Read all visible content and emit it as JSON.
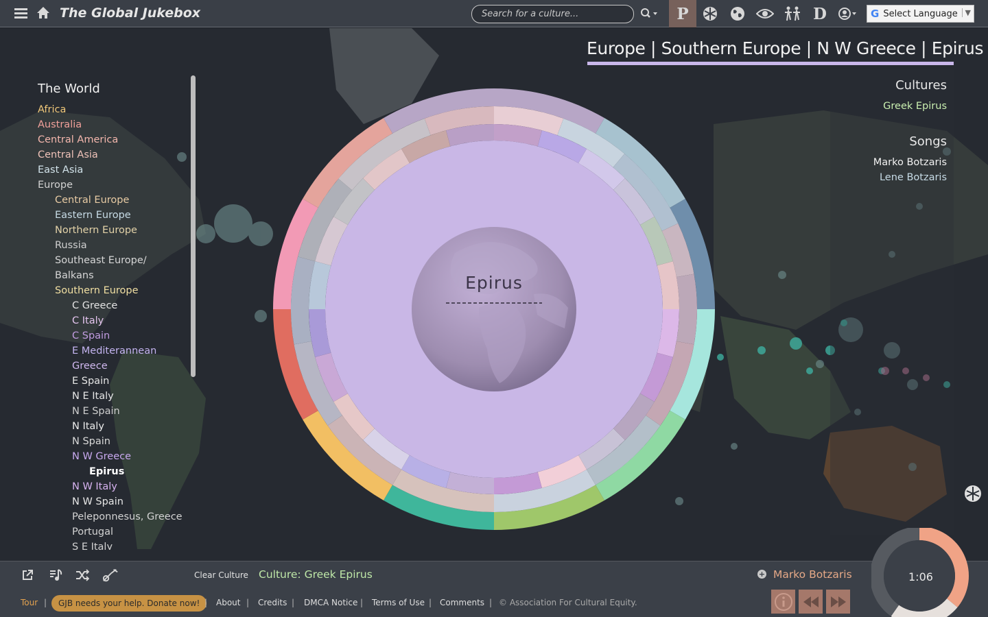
{
  "app": {
    "title": "The Global Jukebox"
  },
  "search": {
    "placeholder": "Search for a culture..."
  },
  "nav_icons": [
    {
      "name": "p-icon",
      "glyph": "P",
      "active": true
    },
    {
      "name": "dancer-wheel-icon",
      "glyph": "",
      "active": false
    },
    {
      "name": "globe-icon",
      "glyph": "",
      "active": false
    },
    {
      "name": "eye-icon",
      "glyph": "",
      "active": false
    },
    {
      "name": "dancers-icon",
      "glyph": "",
      "active": false
    },
    {
      "name": "d-icon",
      "glyph": "D",
      "active": false
    },
    {
      "name": "user-icon",
      "glyph": "",
      "active": false
    }
  ],
  "language": {
    "label": "Select Language"
  },
  "breadcrumb": {
    "text": "Europe | Southern Europe | N W Greece | Epirus"
  },
  "tree": {
    "heading": "The World",
    "items": [
      {
        "label": "Africa",
        "color": "#f2c97a"
      },
      {
        "label": "Australia",
        "color": "#f0a09a"
      },
      {
        "label": "Central America",
        "color": "#f4b7ad"
      },
      {
        "label": "Central Asia",
        "color": "#f0c3b9"
      },
      {
        "label": "East Asia",
        "color": "#d2e3ea"
      },
      {
        "label": "Europe",
        "color": "#d3d3d3"
      },
      {
        "label": "Central Europe",
        "color": "#e8cba4"
      },
      {
        "label": "Eastern Europe",
        "color": "#c7dbe6"
      },
      {
        "label": "Northern Europe",
        "color": "#e3d2a8"
      },
      {
        "label": "Russia",
        "color": "#d0d0d0"
      },
      {
        "label": "Southeast Europe/",
        "color": "#d6d6d6"
      },
      {
        "label": "Balkans",
        "color": "#d6d6d6"
      },
      {
        "label": "Southern Europe",
        "color": "#f1dfa2"
      },
      {
        "label": "C Greece",
        "color": "#e3e3e3"
      },
      {
        "label": "C Italy",
        "color": "#e4c4ee"
      },
      {
        "label": "C Spain",
        "color": "#c19ce0"
      },
      {
        "label": "E Mediterannean",
        "color": "#c4b4f0"
      },
      {
        "label": "Greece",
        "color": "#d0b8ef"
      },
      {
        "label": "E Spain",
        "color": "#e6e6e6"
      },
      {
        "label": "N E Italy",
        "color": "#e6e6e6"
      },
      {
        "label": "N E Spain",
        "color": "#cfcfcf"
      },
      {
        "label": "N Italy",
        "color": "#ececec"
      },
      {
        "label": "N Spain",
        "color": "#d9d9d9"
      },
      {
        "label": "N W Greece",
        "color": "#c8a9ef"
      },
      {
        "label": "Epirus",
        "color": "#ffffff"
      },
      {
        "label": "N W Italy",
        "color": "#d7b3f0"
      },
      {
        "label": "N W Spain",
        "color": "#e6e6e6"
      },
      {
        "label": "Peleponnesus, Greece",
        "color": "#d3d3d3"
      },
      {
        "label": "Portugal",
        "color": "#d3d3d3"
      },
      {
        "label": "S E Italy",
        "color": "#d3d3d3"
      }
    ]
  },
  "cultures": {
    "heading": "Cultures",
    "items": [
      {
        "label": "Greek Epirus",
        "color": "#c9efb0"
      }
    ]
  },
  "songs": {
    "heading": "Songs",
    "items": [
      {
        "label": "Marko Botzaris",
        "color": "#f2f2f2"
      },
      {
        "label": "Lene Botzaris",
        "color": "#c7dbe6"
      }
    ]
  },
  "wheel": {
    "center_label": "Epirus"
  },
  "player": {
    "clear_label": "Clear Culture",
    "culture_label": "Culture: Greek Epirus",
    "now_playing": "Marko Botzaris",
    "time": "1:06",
    "progress": 0.36
  },
  "footer": {
    "tour": "Tour",
    "donate": "GJB needs your help. Donate now!",
    "links": [
      "About",
      "Credits",
      "DMCA Notice",
      "Terms of Use",
      "Comments"
    ],
    "copyright": "© Association For Cultural Equity."
  },
  "colors": {
    "accent_lavender": "#c9b7ea",
    "bar": "#3b4048",
    "footer_button": "#a5786a"
  }
}
